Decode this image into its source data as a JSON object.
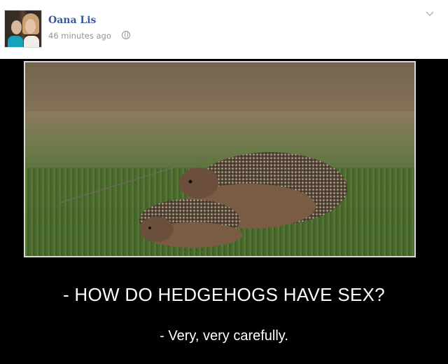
{
  "post": {
    "author": "Oana Lis",
    "timestamp": "46 minutes ago",
    "privacy_icon": "globe-icon",
    "menu_icon": "chevron-down-icon"
  },
  "image": {
    "headline": "- HOW DO HEDGEHOGS HAVE SEX?",
    "subline": "- Very, very carefully."
  },
  "colors": {
    "author_link": "#3b5998",
    "meta_text": "#90949c",
    "poster_background": "#000000"
  }
}
